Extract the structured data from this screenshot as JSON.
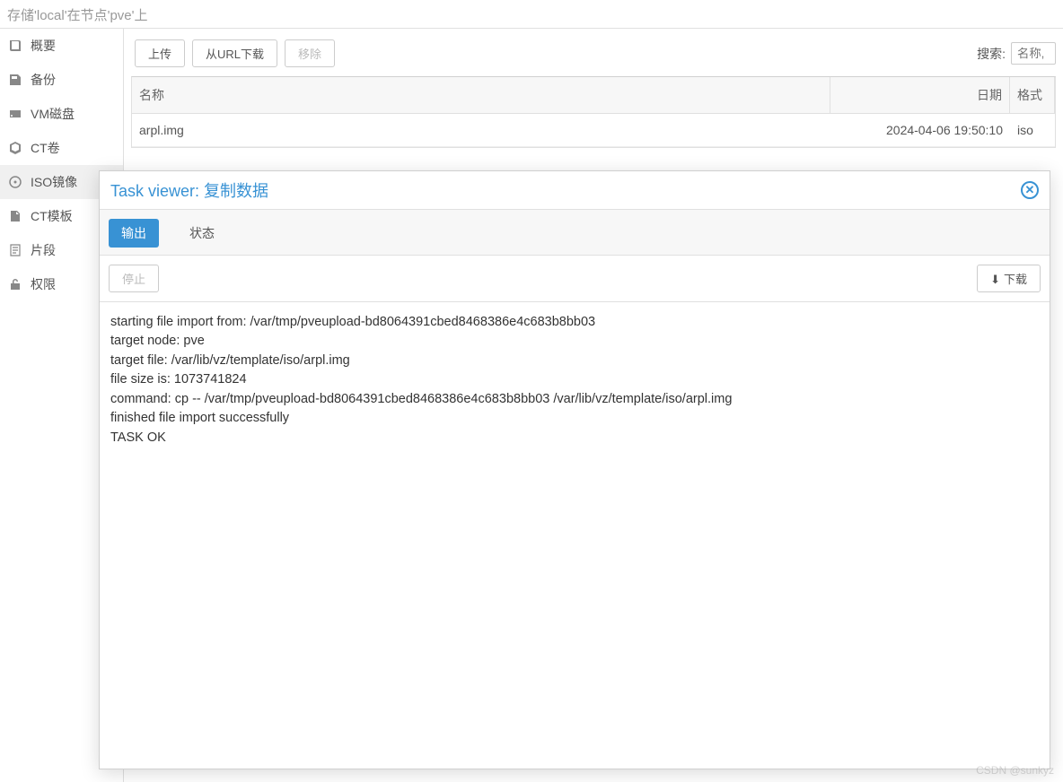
{
  "breadcrumb": "存储'local'在节点'pve'上",
  "sidebar": {
    "items": [
      {
        "label": "概要"
      },
      {
        "label": "备份"
      },
      {
        "label": "VM磁盘"
      },
      {
        "label": "CT卷"
      },
      {
        "label": "ISO镜像"
      },
      {
        "label": "CT模板"
      },
      {
        "label": "片段"
      },
      {
        "label": "权限"
      }
    ]
  },
  "toolbar": {
    "upload": "上传",
    "download_url": "从URL下载",
    "remove": "移除",
    "search_label": "搜索:",
    "search_placeholder": "名称,"
  },
  "table": {
    "headers": {
      "name": "名称",
      "date": "日期",
      "format": "格式"
    },
    "rows": [
      {
        "name": "arpl.img",
        "date": "2024-04-06 19:50:10",
        "format": "iso"
      }
    ]
  },
  "dialog": {
    "title": "Task viewer: 复制数据",
    "tabs": {
      "output": "输出",
      "status": "状态"
    },
    "stop": "停止",
    "download": "下载",
    "log": "starting file import from: /var/tmp/pveupload-bd8064391cbed8468386e4c683b8bb03\ntarget node: pve\ntarget file: /var/lib/vz/template/iso/arpl.img\nfile size is: 1073741824\ncommand: cp -- /var/tmp/pveupload-bd8064391cbed8468386e4c683b8bb03 /var/lib/vz/template/iso/arpl.img\nfinished file import successfully\nTASK OK"
  },
  "watermark": "CSDN @sunkyz"
}
